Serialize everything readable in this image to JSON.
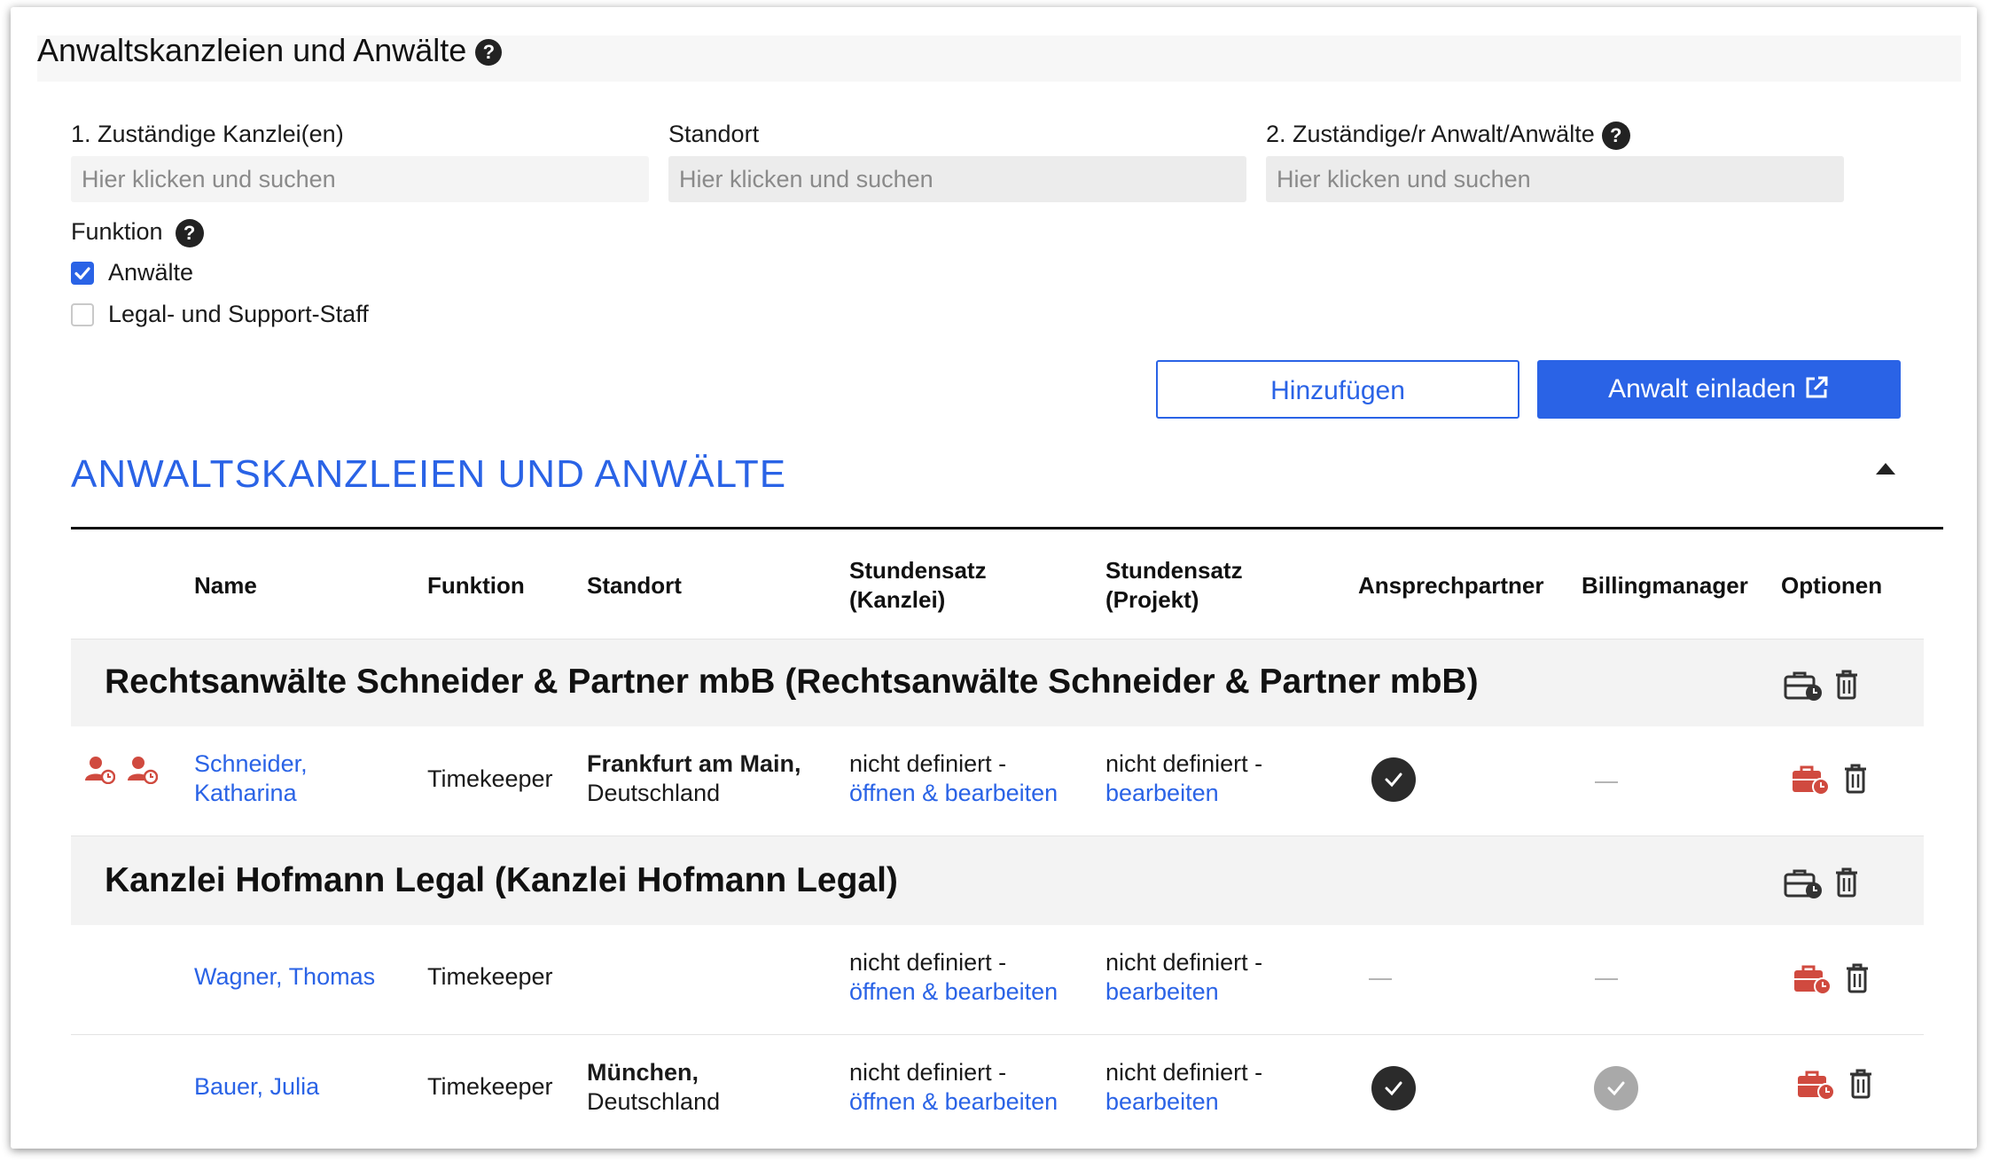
{
  "header": {
    "title": "Anwaltskanzleien und Anwälte",
    "help_icon": "question-circle-icon"
  },
  "filters": {
    "kanzlei_label": "1. Zuständige Kanzlei(en)",
    "kanzlei_placeholder": "Hier klicken und suchen",
    "standort_label": "Standort",
    "standort_placeholder": "Hier klicken und suchen",
    "anwalt_label": "2. Zuständige/r Anwalt/Anwälte",
    "anwalt_placeholder": "Hier klicken und suchen",
    "funktion_label": "Funktion",
    "options": [
      {
        "label": "Anwälte",
        "checked": true
      },
      {
        "label": "Legal- und Support-Staff",
        "checked": false
      }
    ]
  },
  "actions": {
    "add_label": "Hinzufügen",
    "invite_label": "Anwalt einladen",
    "invite_icon": "external-link-icon"
  },
  "section": {
    "title": "ANWALTSKANZLEIEN UND ANWÄLTE",
    "collapse_icon": "caret-up-icon"
  },
  "table": {
    "headers": {
      "name": "Name",
      "funktion": "Funktion",
      "standort": "Standort",
      "rate_kanzlei_1": "Stundensatz",
      "rate_kanzlei_2": "(Kanzlei)",
      "rate_projekt_1": "Stundensatz",
      "rate_projekt_2": "(Projekt)",
      "ansprechpartner": "Ansprechpartner",
      "billing": "Billingmanager",
      "optionen": "Optionen"
    },
    "firms": [
      {
        "name": "Rechtsanwälte Schneider & Partner mbB (Rechtsanwälte Schneider & Partner mbB)",
        "lawyers": [
          {
            "name_1": "Schneider,",
            "name_2": "Katharina",
            "funktion": "Timekeeper",
            "standort_1": "Frankfurt am Main,",
            "standort_2": "Deutschland",
            "rate_kanzlei_1": "nicht definiert -",
            "rate_kanzlei_2": "öffnen & bearbeiten",
            "rate_projekt_1": "nicht definiert -",
            "rate_projekt_2": "bearbeiten",
            "ansprechpartner": true,
            "billing": false
          }
        ]
      },
      {
        "name": "Kanzlei Hofmann Legal (Kanzlei Hofmann Legal)",
        "lawyers": [
          {
            "name_1": "Wagner, Thomas",
            "funktion": "Timekeeper",
            "rate_kanzlei_1": "nicht definiert -",
            "rate_kanzlei_2": "öffnen & bearbeiten",
            "rate_projekt_1": "nicht definiert -",
            "rate_projekt_2": "bearbeiten",
            "ansprechpartner": false,
            "billing": false
          },
          {
            "name_1": "Bauer, Julia",
            "funktion": "Timekeeper",
            "standort_1": "München,",
            "standort_2": "Deutschland",
            "rate_kanzlei_1": "nicht definiert -",
            "rate_kanzlei_2": "öffnen & bearbeiten",
            "rate_projekt_1": "nicht definiert -",
            "rate_projekt_2": "bearbeiten",
            "ansprechpartner": true,
            "billing": "inactive"
          }
        ]
      }
    ]
  },
  "colors": {
    "accent": "#2a63e6",
    "danger": "#d04a3f",
    "dark": "#2b2b2b",
    "muted": "#a9a9a9"
  }
}
